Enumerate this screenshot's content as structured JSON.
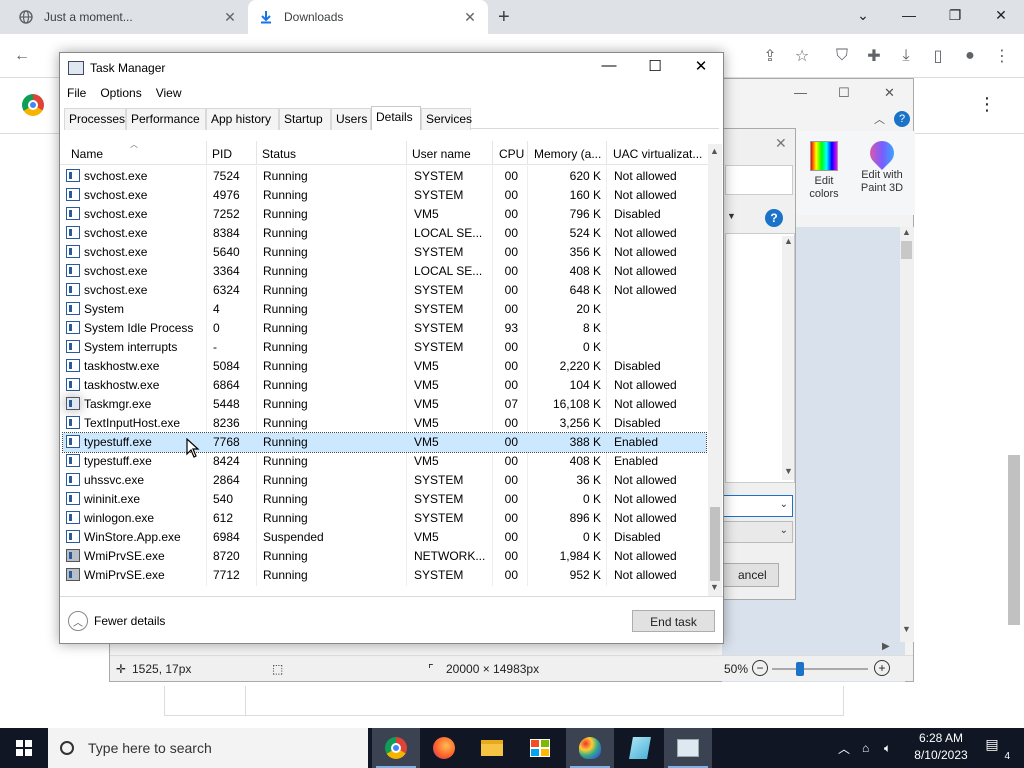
{
  "browser": {
    "tabs": [
      {
        "title": "Just a moment...",
        "active": false
      },
      {
        "title": "Downloads",
        "active": true
      }
    ]
  },
  "paint": {
    "ribbon": [
      {
        "label_line1": "Edit",
        "label_line2": "colors",
        "icon": "edit-colors-icon"
      },
      {
        "label_line1": "Edit with",
        "label_line2": "Paint 3D",
        "icon": "paint3d-icon"
      }
    ],
    "dialog_cancel": "ancel",
    "status": {
      "cursor_pos": "1525, 17px",
      "image_size": "20000 × 14983px",
      "zoom": "50%"
    }
  },
  "taskmanager": {
    "title": "Task Manager",
    "menu": [
      "File",
      "Options",
      "View"
    ],
    "tabs": [
      "Processes",
      "Performance",
      "App history",
      "Startup",
      "Users",
      "Details",
      "Services"
    ],
    "active_tab": "Details",
    "columns": [
      "Name",
      "PID",
      "Status",
      "User name",
      "CPU",
      "Memory (a...",
      "UAC virtualizat..."
    ],
    "rows": [
      {
        "name": "svchost.exe",
        "pid": "7524",
        "status": "Running",
        "user": "SYSTEM",
        "cpu": "00",
        "mem": "620 K",
        "uac": "Not allowed",
        "icon": "svc"
      },
      {
        "name": "svchost.exe",
        "pid": "4976",
        "status": "Running",
        "user": "SYSTEM",
        "cpu": "00",
        "mem": "160 K",
        "uac": "Not allowed",
        "icon": "svc"
      },
      {
        "name": "svchost.exe",
        "pid": "7252",
        "status": "Running",
        "user": "VM5",
        "cpu": "00",
        "mem": "796 K",
        "uac": "Disabled",
        "icon": "svc"
      },
      {
        "name": "svchost.exe",
        "pid": "8384",
        "status": "Running",
        "user": "LOCAL SE...",
        "cpu": "00",
        "mem": "524 K",
        "uac": "Not allowed",
        "icon": "svc"
      },
      {
        "name": "svchost.exe",
        "pid": "5640",
        "status": "Running",
        "user": "SYSTEM",
        "cpu": "00",
        "mem": "356 K",
        "uac": "Not allowed",
        "icon": "svc"
      },
      {
        "name": "svchost.exe",
        "pid": "3364",
        "status": "Running",
        "user": "LOCAL SE...",
        "cpu": "00",
        "mem": "408 K",
        "uac": "Not allowed",
        "icon": "svc"
      },
      {
        "name": "svchost.exe",
        "pid": "6324",
        "status": "Running",
        "user": "SYSTEM",
        "cpu": "00",
        "mem": "648 K",
        "uac": "Not allowed",
        "icon": "svc"
      },
      {
        "name": "System",
        "pid": "4",
        "status": "Running",
        "user": "SYSTEM",
        "cpu": "00",
        "mem": "20 K",
        "uac": "",
        "icon": "svc"
      },
      {
        "name": "System Idle Process",
        "pid": "0",
        "status": "Running",
        "user": "SYSTEM",
        "cpu": "93",
        "mem": "8 K",
        "uac": "",
        "icon": "svc"
      },
      {
        "name": "System interrupts",
        "pid": "-",
        "status": "Running",
        "user": "SYSTEM",
        "cpu": "00",
        "mem": "0 K",
        "uac": "",
        "icon": "svc"
      },
      {
        "name": "taskhostw.exe",
        "pid": "5084",
        "status": "Running",
        "user": "VM5",
        "cpu": "00",
        "mem": "2,220 K",
        "uac": "Disabled",
        "icon": "svc"
      },
      {
        "name": "taskhostw.exe",
        "pid": "6864",
        "status": "Running",
        "user": "VM5",
        "cpu": "00",
        "mem": "104 K",
        "uac": "Not allowed",
        "icon": "svc"
      },
      {
        "name": "Taskmgr.exe",
        "pid": "5448",
        "status": "Running",
        "user": "VM5",
        "cpu": "07",
        "mem": "16,108 K",
        "uac": "Not allowed",
        "icon": "tm"
      },
      {
        "name": "TextInputHost.exe",
        "pid": "8236",
        "status": "Running",
        "user": "VM5",
        "cpu": "00",
        "mem": "3,256 K",
        "uac": "Disabled",
        "icon": "svc"
      },
      {
        "name": "typestuff.exe",
        "pid": "7768",
        "status": "Running",
        "user": "VM5",
        "cpu": "00",
        "mem": "388 K",
        "uac": "Enabled",
        "icon": "svc",
        "selected": true
      },
      {
        "name": "typestuff.exe",
        "pid": "8424",
        "status": "Running",
        "user": "VM5",
        "cpu": "00",
        "mem": "408 K",
        "uac": "Enabled",
        "icon": "svc"
      },
      {
        "name": "uhssvc.exe",
        "pid": "2864",
        "status": "Running",
        "user": "SYSTEM",
        "cpu": "00",
        "mem": "36 K",
        "uac": "Not allowed",
        "icon": "svc"
      },
      {
        "name": "wininit.exe",
        "pid": "540",
        "status": "Running",
        "user": "SYSTEM",
        "cpu": "00",
        "mem": "0 K",
        "uac": "Not allowed",
        "icon": "svc"
      },
      {
        "name": "winlogon.exe",
        "pid": "612",
        "status": "Running",
        "user": "SYSTEM",
        "cpu": "00",
        "mem": "896 K",
        "uac": "Not allowed",
        "icon": "svc"
      },
      {
        "name": "WinStore.App.exe",
        "pid": "6984",
        "status": "Suspended",
        "user": "VM5",
        "cpu": "00",
        "mem": "0 K",
        "uac": "Disabled",
        "icon": "svc"
      },
      {
        "name": "WmiPrvSE.exe",
        "pid": "8720",
        "status": "Running",
        "user": "NETWORK...",
        "cpu": "00",
        "mem": "1,984 K",
        "uac": "Not allowed",
        "icon": "wmi"
      },
      {
        "name": "WmiPrvSE.exe",
        "pid": "7712",
        "status": "Running",
        "user": "SYSTEM",
        "cpu": "00",
        "mem": "952 K",
        "uac": "Not allowed",
        "icon": "wmi"
      }
    ],
    "fewer_details": "Fewer details",
    "end_task": "End task"
  },
  "taskbar": {
    "search_placeholder": "Type here to search",
    "apps": [
      "chrome-icon",
      "firefox-icon",
      "file-explorer-icon",
      "store-icon",
      "paint-icon",
      "notepad-icon",
      "task-manager-icon"
    ],
    "time": "6:28 AM",
    "date": "8/10/2023",
    "notifications": "4"
  },
  "colors": {
    "selection": "#cce8ff",
    "taskbar": "#101623",
    "accent": "#1a73c8"
  }
}
